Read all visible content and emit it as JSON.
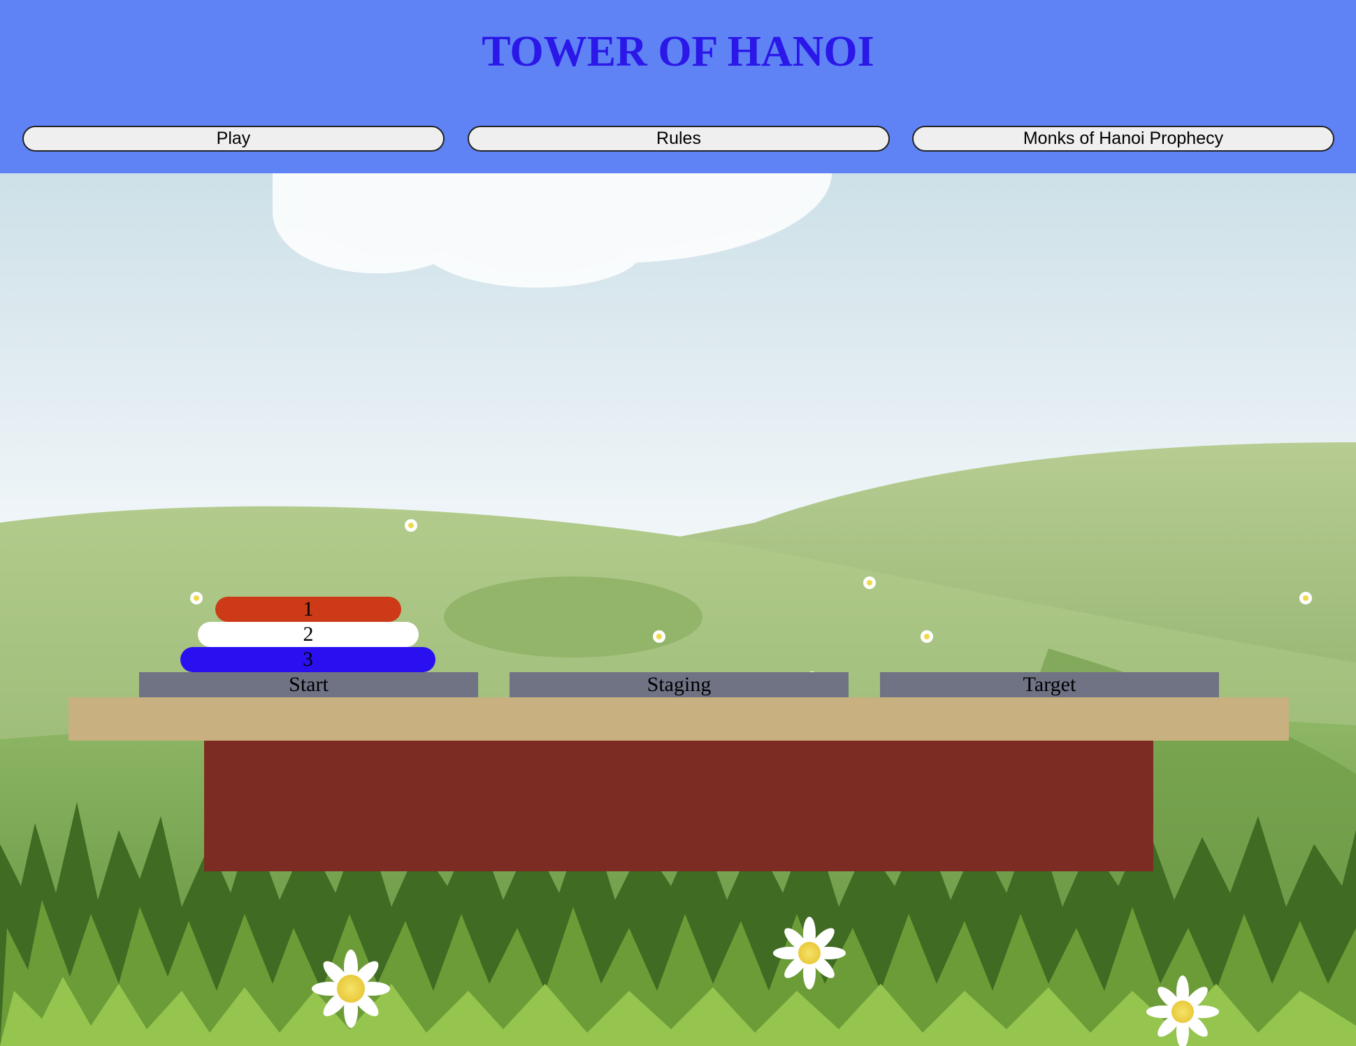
{
  "header": {
    "title": "TOWER OF HANOI",
    "nav": {
      "play_label": "Play",
      "rules_label": "Rules",
      "prophecy_label": "Monks of Hanoi Prophecy"
    }
  },
  "game": {
    "pegs": {
      "start_label": "Start",
      "staging_label": "Staging",
      "target_label": "Target"
    },
    "disks": [
      {
        "label": "1",
        "color": "#cc3a18",
        "peg": "Start"
      },
      {
        "label": "2",
        "color": "#ffffff",
        "peg": "Start"
      },
      {
        "label": "3",
        "color": "#2a10f0",
        "peg": "Start"
      }
    ]
  },
  "colors": {
    "header_bg": "#5f83f5",
    "title": "#2a17e8",
    "peg_label_bg": "#6f7384",
    "platform": "#c8b080",
    "base": "#7c2c22"
  }
}
